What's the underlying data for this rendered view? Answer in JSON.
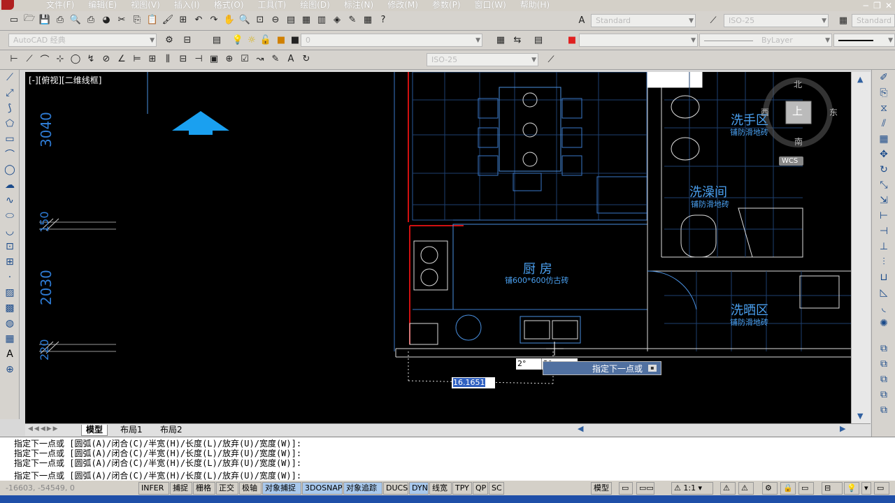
{
  "menu": {
    "items": [
      "文件(F)",
      "编辑(E)",
      "视图(V)",
      "插入(I)",
      "格式(O)",
      "工具(T)",
      "绘图(D)",
      "标注(N)",
      "修改(M)",
      "参数(P)",
      "窗口(W)",
      "帮助(H)"
    ]
  },
  "toolbar": {
    "text_style": "Standard",
    "dim_style": "ISO-25",
    "table_style": "Standard",
    "workspace": "AutoCAD 经典",
    "linetype": "ByLayer",
    "layer": "0",
    "dim_style2": "ISO-25"
  },
  "viewport": {
    "label": "[-][俯视][二维线框]",
    "compass": {
      "north": "北",
      "south": "南",
      "east": "东",
      "west": "西",
      "top": "上",
      "wcs": "WCS"
    }
  },
  "drawing": {
    "rooms": [
      {
        "name": "洗手区",
        "floor": "铺防滑地砖"
      },
      {
        "name": "洗澡间",
        "floor": "铺防滑地砖"
      },
      {
        "name": "厨  房",
        "floor": "铺600*600仿古砖"
      },
      {
        "name": "洗晒区",
        "floor": "铺防滑地砖"
      }
    ],
    "dims": [
      "3040",
      "150",
      "2030",
      "220"
    ],
    "tooltip_prompt": "指定下一点或",
    "input_value": "16.1651",
    "angle_a": "2°",
    "angle_b": "2°"
  },
  "tabs": [
    "模型",
    "布局1",
    "布局2"
  ],
  "command": {
    "lines": [
      "指定下一点或 [圆弧(A)/闭合(C)/半宽(H)/长度(L)/放弃(U)/宽度(W)]:",
      "指定下一点或 [圆弧(A)/闭合(C)/半宽(H)/长度(L)/放弃(U)/宽度(W)]:",
      "指定下一点或 [圆弧(A)/闭合(C)/半宽(H)/长度(L)/放弃(U)/宽度(W)]:",
      "指定下一点或 [圆弧(A)/闭合(C)/半宽(H)/长度(L)/放弃(U)/宽度(W)]:"
    ]
  },
  "status": {
    "coords": "-16603, -54549, 0",
    "toggles": [
      {
        "label": "INFER",
        "on": false
      },
      {
        "label": "捕捉",
        "on": false
      },
      {
        "label": "栅格",
        "on": false
      },
      {
        "label": "正交",
        "on": false
      },
      {
        "label": "极轴",
        "on": false
      },
      {
        "label": "对象捕捉",
        "on": true
      },
      {
        "label": "3DOSNAP",
        "on": true
      },
      {
        "label": "对象追踪",
        "on": true
      },
      {
        "label": "DUCS",
        "on": false
      },
      {
        "label": "DYN",
        "on": true
      },
      {
        "label": "线宽",
        "on": false
      },
      {
        "label": "TPY",
        "on": false
      },
      {
        "label": "QP",
        "on": false
      },
      {
        "label": "SC",
        "on": false
      }
    ],
    "model_label": "模型",
    "scale": "1:1"
  }
}
